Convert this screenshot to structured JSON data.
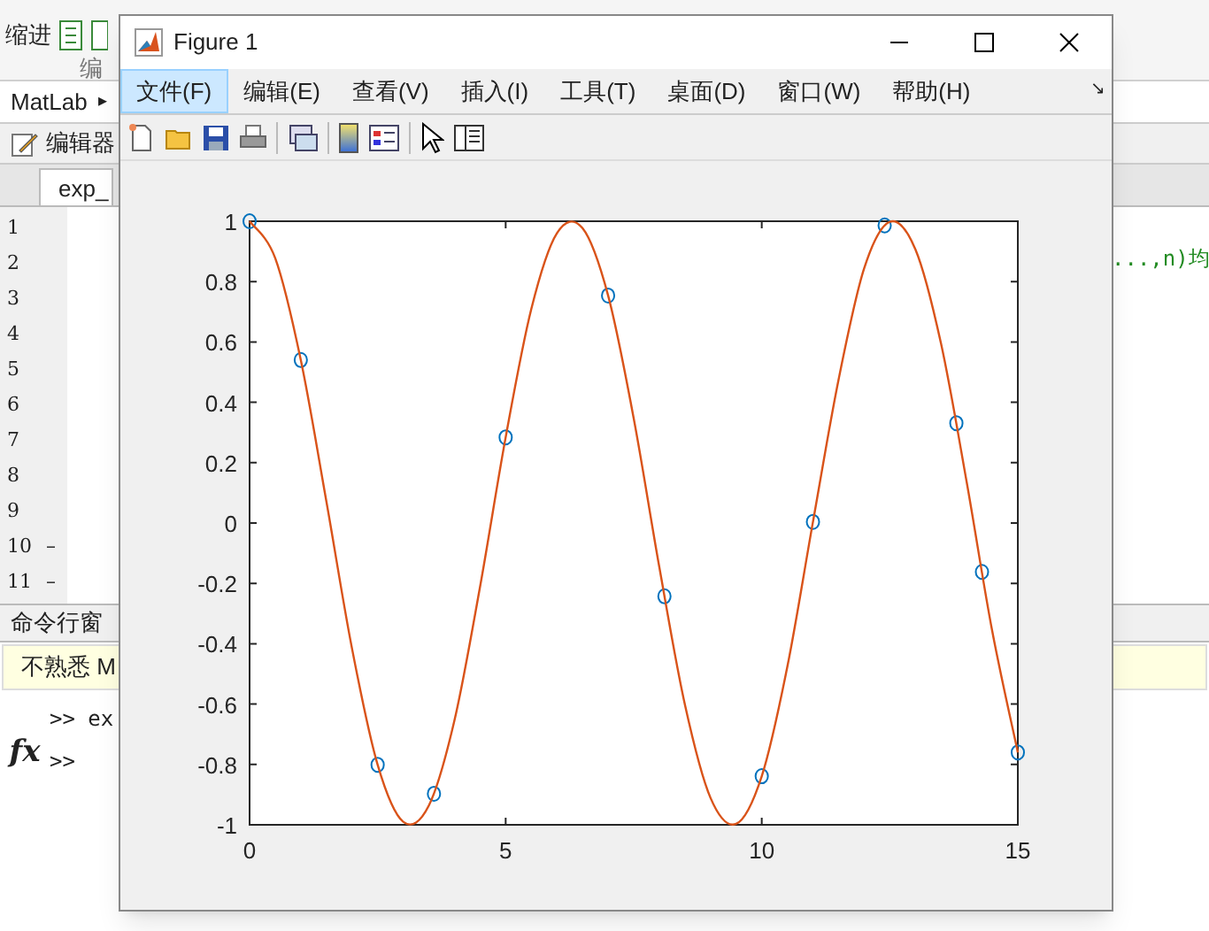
{
  "ide": {
    "indent_label": "缩进",
    "group_label": "编",
    "address": "MatLab",
    "address_arrow": "▸",
    "editor_label": "编辑器",
    "file_tab": "exp_",
    "line_numbers": [
      {
        "n": "1"
      },
      {
        "n": "2"
      },
      {
        "n": "3"
      },
      {
        "n": "4"
      },
      {
        "n": "5"
      },
      {
        "n": "6"
      },
      {
        "n": "7"
      },
      {
        "n": "8"
      },
      {
        "n": "9"
      },
      {
        "n": "10",
        "mark": "–"
      },
      {
        "n": "11",
        "mark": "–"
      }
    ],
    "code_fragment": "...,n)均",
    "command_header": "命令行窗",
    "notice": "不熟悉 M",
    "prompts": [
      ">> ex",
      ">>"
    ],
    "fx": "fx"
  },
  "figure": {
    "title": "Figure 1",
    "menu": [
      {
        "label": "文件(F)",
        "selected": true
      },
      {
        "label": "编辑(E)",
        "selected": false
      },
      {
        "label": "查看(V)",
        "selected": false
      },
      {
        "label": "插入(I)",
        "selected": false
      },
      {
        "label": "工具(T)",
        "selected": false
      },
      {
        "label": "桌面(D)",
        "selected": false
      },
      {
        "label": "窗口(W)",
        "selected": false
      },
      {
        "label": "帮助(H)",
        "selected": false
      }
    ],
    "dock_arrow": "↘",
    "chart_data": {
      "type": "line",
      "xlim": [
        0,
        15
      ],
      "ylim": [
        -1,
        1
      ],
      "xticks": [
        0,
        5,
        10,
        15
      ],
      "yticks": [
        -1,
        -0.8,
        -0.6,
        -0.4,
        -0.2,
        0,
        0.2,
        0.4,
        0.6,
        0.8,
        1
      ],
      "x": [
        0,
        0.5,
        1,
        1.5,
        2,
        2.5,
        3,
        3.5,
        4,
        4.5,
        5,
        5.5,
        6,
        6.5,
        7,
        7.5,
        8,
        8.5,
        9,
        9.5,
        10,
        10.5,
        11,
        11.5,
        12,
        12.5,
        13,
        13.5,
        14,
        14.5,
        15
      ],
      "series": [
        {
          "type": "scatter",
          "marker": "o",
          "color": "#0072bd",
          "x": [
            0,
            1,
            2.5,
            3.6,
            5,
            7,
            8.1,
            10,
            11,
            12.4,
            13.8,
            14.3,
            15
          ],
          "values": [
            1,
            0.54,
            -0.801,
            -0.897,
            0.284,
            0.754,
            -0.243,
            -0.839,
            0.004,
            0.986,
            0.331,
            -0.162,
            -0.76
          ]
        },
        {
          "type": "line",
          "color": "#d95319",
          "values": [
            1,
            0.878,
            0.54,
            0.071,
            -0.416,
            -0.801,
            -0.99,
            -0.936,
            -0.654,
            -0.211,
            0.284,
            0.709,
            0.96,
            0.977,
            0.754,
            0.347,
            -0.146,
            -0.602,
            -0.911,
            -0.997,
            -0.839,
            -0.476,
            0.004,
            0.475,
            0.844,
            0.998,
            0.907,
            0.595,
            0.137,
            -0.358,
            -0.76
          ]
        }
      ]
    }
  }
}
